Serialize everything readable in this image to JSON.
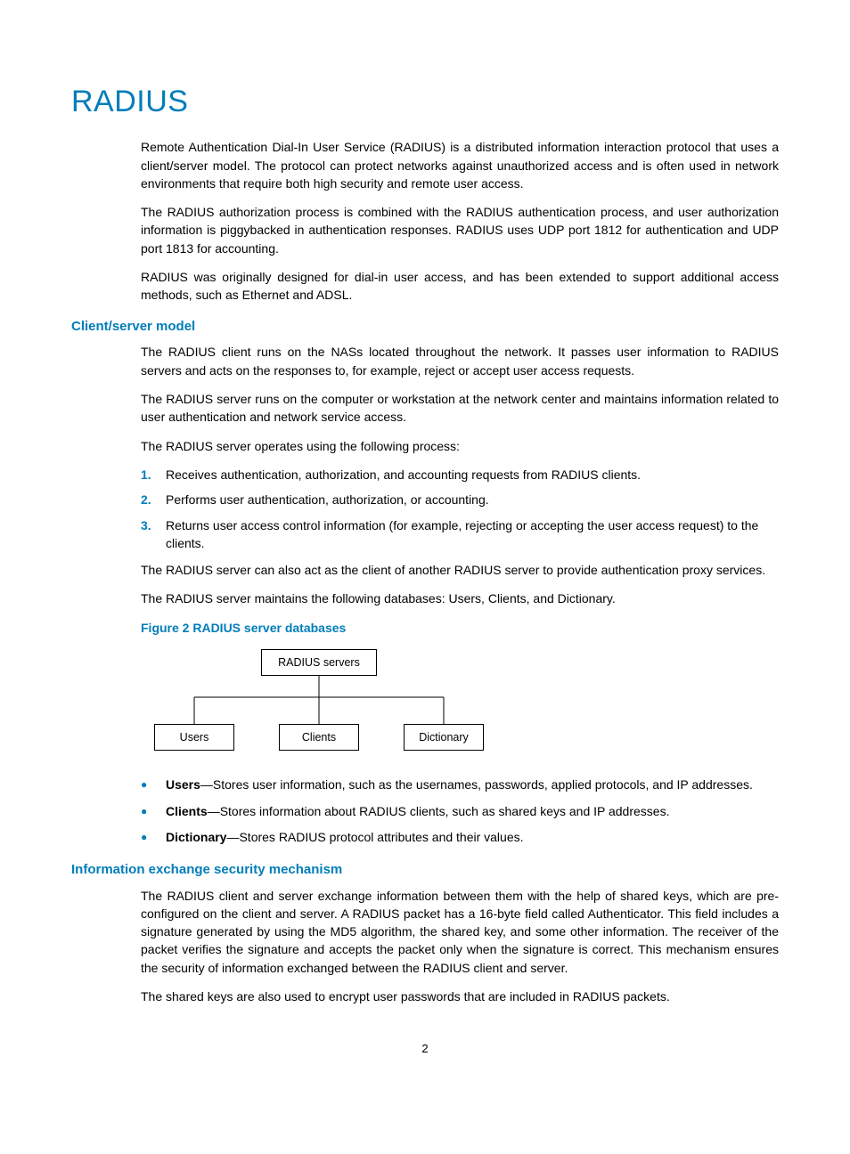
{
  "title": "RADIUS",
  "intro": [
    "Remote Authentication Dial-In User Service (RADIUS) is a distributed information interaction protocol that uses a client/server model. The protocol can protect networks against unauthorized access and is often used in network environments that require both high security and remote user access.",
    "The RADIUS authorization process is combined with the RADIUS authentication process, and user authorization information is piggybacked in authentication responses. RADIUS uses UDP port 1812 for authentication and UDP port 1813 for accounting.",
    "RADIUS was originally designed for dial-in user access, and has been extended to support additional access methods, such as Ethernet and ADSL."
  ],
  "sections": {
    "client_server": {
      "heading": "Client/server model",
      "paras_top": [
        "The RADIUS client runs on the NASs located throughout the network. It passes user information to RADIUS servers and acts on the responses to, for example, reject or accept user access requests.",
        "The RADIUS server runs on the computer or workstation at the network center and maintains information related to user authentication and network service access.",
        "The RADIUS server operates using the following process:"
      ],
      "steps": [
        "Receives authentication, authorization, and accounting requests from RADIUS clients.",
        "Performs user authentication, authorization, or accounting.",
        "Returns user access control information (for example, rejecting or accepting the user access request) to the clients."
      ],
      "paras_mid": [
        "The RADIUS server can also act as the client of another RADIUS server to provide authentication proxy services.",
        "The RADIUS server maintains the following databases: Users, Clients, and Dictionary."
      ],
      "figure_caption": "Figure 2 RADIUS server databases",
      "diagram": {
        "top": "RADIUS servers",
        "left": "Users",
        "center": "Clients",
        "right": "Dictionary"
      },
      "db_list": [
        {
          "term": "Users",
          "desc": "—Stores user information, such as the usernames, passwords, applied protocols, and IP addresses."
        },
        {
          "term": "Clients",
          "desc": "—Stores information about RADIUS clients, such as shared keys and IP addresses."
        },
        {
          "term": "Dictionary",
          "desc": "—Stores RADIUS protocol attributes and their values."
        }
      ]
    },
    "security": {
      "heading": "Information exchange security mechanism",
      "paras": [
        "The RADIUS client and server exchange information between them with the help of shared keys, which are pre-configured on the client and server. A RADIUS packet has a 16-byte field called Authenticator. This field includes a signature generated by using the MD5 algorithm, the shared key, and some other information. The receiver of the packet verifies the signature and accepts the packet only when the signature is correct. This mechanism ensures the security of information exchanged between the RADIUS client and server.",
        "The shared keys are also used to encrypt user passwords that are included in RADIUS packets."
      ]
    }
  },
  "page_number": "2"
}
